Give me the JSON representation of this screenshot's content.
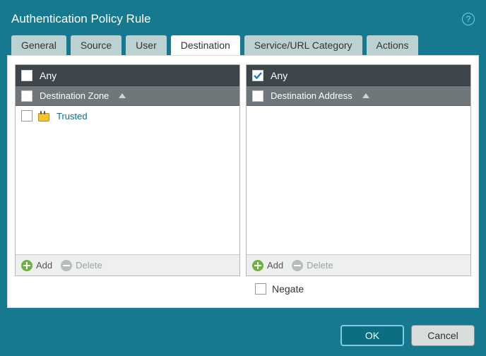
{
  "title": "Authentication Policy Rule",
  "tabs": [
    "General",
    "Source",
    "User",
    "Destination",
    "Service/URL Category",
    "Actions"
  ],
  "active_tab": 3,
  "left_panel": {
    "any_label": "Any",
    "any_checked": false,
    "column_label": "Destination Zone",
    "rows": [
      {
        "label": "Trusted",
        "checked": false
      }
    ],
    "add_label": "Add",
    "delete_label": "Delete"
  },
  "right_panel": {
    "any_label": "Any",
    "any_checked": true,
    "column_label": "Destination Address",
    "rows": [],
    "add_label": "Add",
    "delete_label": "Delete"
  },
  "negate": {
    "label": "Negate",
    "checked": false
  },
  "buttons": {
    "ok": "OK",
    "cancel": "Cancel"
  }
}
